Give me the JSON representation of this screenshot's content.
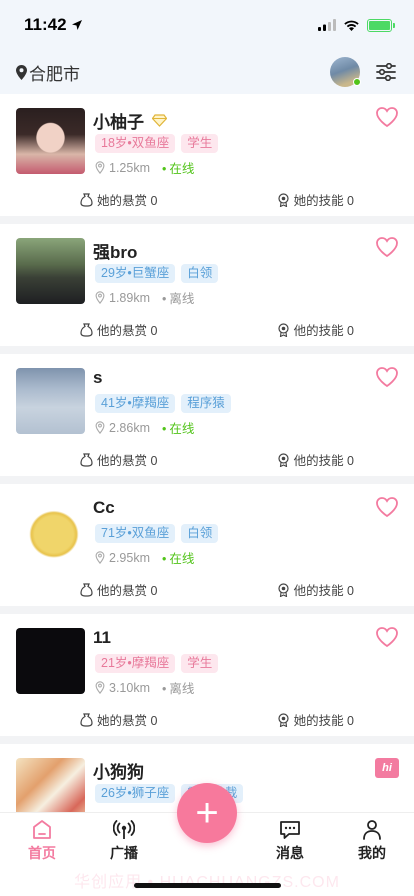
{
  "status_bar": {
    "time": "11:42"
  },
  "header": {
    "city": "合肥市"
  },
  "cards": [
    {
      "name": "小柚子",
      "age_sign": "18岁•双鱼座",
      "job": "学生",
      "gender": "female",
      "distance": "1.25km",
      "status": "在线",
      "online": true,
      "reward_label": "她的悬赏 0",
      "skill_label": "她的技能 0",
      "verified": true,
      "action": "heart"
    },
    {
      "name": "强bro",
      "age_sign": "29岁•巨蟹座",
      "job": "白领",
      "gender": "male",
      "distance": "1.89km",
      "status": "离线",
      "online": false,
      "reward_label": "他的悬赏 0",
      "skill_label": "他的技能 0",
      "verified": false,
      "action": "heart"
    },
    {
      "name": "s",
      "age_sign": "41岁•摩羯座",
      "job": "程序猿",
      "gender": "male",
      "distance": "2.86km",
      "status": "在线",
      "online": true,
      "reward_label": "他的悬赏 0",
      "skill_label": "他的技能 0",
      "verified": false,
      "action": "heart"
    },
    {
      "name": "Cc",
      "age_sign": "71岁•双鱼座",
      "job": "白领",
      "gender": "male",
      "distance": "2.95km",
      "status": "在线",
      "online": true,
      "reward_label": "他的悬赏 0",
      "skill_label": "他的技能 0",
      "verified": false,
      "action": "heart"
    },
    {
      "name": "11",
      "age_sign": "21岁•摩羯座",
      "job": "学生",
      "gender": "female",
      "distance": "3.10km",
      "status": "离线",
      "online": false,
      "reward_label": "她的悬赏 0",
      "skill_label": "她的技能 0",
      "verified": false,
      "action": "heart"
    },
    {
      "name": "小狗狗",
      "age_sign": "26岁•狮子座",
      "job": "霸道总裁",
      "gender": "male",
      "distance": "",
      "status": "",
      "online": true,
      "reward_label": "",
      "skill_label": "",
      "verified": false,
      "action": "hi",
      "hi_label": "hi"
    }
  ],
  "tab_bar": {
    "home": "首页",
    "broadcast": "广播",
    "messages": "消息",
    "mine": "我的",
    "fab_label": "+"
  },
  "watermark": "华创应用 • HUACHUANGZS.COM",
  "colors": {
    "accent": "#f37ba0",
    "online": "#52c41a",
    "female_tag_bg": "#fde7ee",
    "male_tag_bg": "#e3f0fb"
  }
}
